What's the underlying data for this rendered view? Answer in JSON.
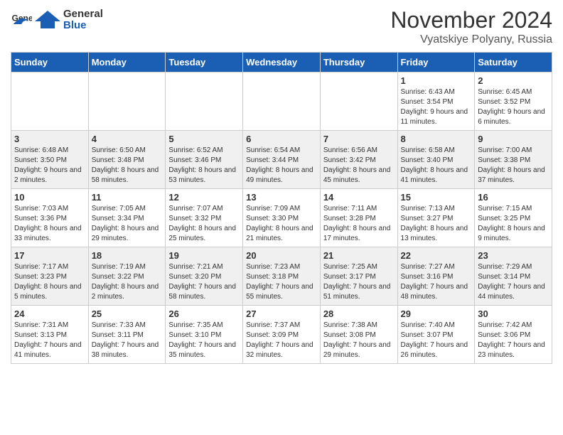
{
  "header": {
    "logo_general": "General",
    "logo_blue": "Blue",
    "month_year": "November 2024",
    "location": "Vyatskiye Polyany, Russia"
  },
  "days_of_week": [
    "Sunday",
    "Monday",
    "Tuesday",
    "Wednesday",
    "Thursday",
    "Friday",
    "Saturday"
  ],
  "weeks": [
    [
      {
        "day": "",
        "info": ""
      },
      {
        "day": "",
        "info": ""
      },
      {
        "day": "",
        "info": ""
      },
      {
        "day": "",
        "info": ""
      },
      {
        "day": "",
        "info": ""
      },
      {
        "day": "1",
        "info": "Sunrise: 6:43 AM\nSunset: 3:54 PM\nDaylight: 9 hours and 11 minutes."
      },
      {
        "day": "2",
        "info": "Sunrise: 6:45 AM\nSunset: 3:52 PM\nDaylight: 9 hours and 6 minutes."
      }
    ],
    [
      {
        "day": "3",
        "info": "Sunrise: 6:48 AM\nSunset: 3:50 PM\nDaylight: 9 hours and 2 minutes."
      },
      {
        "day": "4",
        "info": "Sunrise: 6:50 AM\nSunset: 3:48 PM\nDaylight: 8 hours and 58 minutes."
      },
      {
        "day": "5",
        "info": "Sunrise: 6:52 AM\nSunset: 3:46 PM\nDaylight: 8 hours and 53 minutes."
      },
      {
        "day": "6",
        "info": "Sunrise: 6:54 AM\nSunset: 3:44 PM\nDaylight: 8 hours and 49 minutes."
      },
      {
        "day": "7",
        "info": "Sunrise: 6:56 AM\nSunset: 3:42 PM\nDaylight: 8 hours and 45 minutes."
      },
      {
        "day": "8",
        "info": "Sunrise: 6:58 AM\nSunset: 3:40 PM\nDaylight: 8 hours and 41 minutes."
      },
      {
        "day": "9",
        "info": "Sunrise: 7:00 AM\nSunset: 3:38 PM\nDaylight: 8 hours and 37 minutes."
      }
    ],
    [
      {
        "day": "10",
        "info": "Sunrise: 7:03 AM\nSunset: 3:36 PM\nDaylight: 8 hours and 33 minutes."
      },
      {
        "day": "11",
        "info": "Sunrise: 7:05 AM\nSunset: 3:34 PM\nDaylight: 8 hours and 29 minutes."
      },
      {
        "day": "12",
        "info": "Sunrise: 7:07 AM\nSunset: 3:32 PM\nDaylight: 8 hours and 25 minutes."
      },
      {
        "day": "13",
        "info": "Sunrise: 7:09 AM\nSunset: 3:30 PM\nDaylight: 8 hours and 21 minutes."
      },
      {
        "day": "14",
        "info": "Sunrise: 7:11 AM\nSunset: 3:28 PM\nDaylight: 8 hours and 17 minutes."
      },
      {
        "day": "15",
        "info": "Sunrise: 7:13 AM\nSunset: 3:27 PM\nDaylight: 8 hours and 13 minutes."
      },
      {
        "day": "16",
        "info": "Sunrise: 7:15 AM\nSunset: 3:25 PM\nDaylight: 8 hours and 9 minutes."
      }
    ],
    [
      {
        "day": "17",
        "info": "Sunrise: 7:17 AM\nSunset: 3:23 PM\nDaylight: 8 hours and 5 minutes."
      },
      {
        "day": "18",
        "info": "Sunrise: 7:19 AM\nSunset: 3:22 PM\nDaylight: 8 hours and 2 minutes."
      },
      {
        "day": "19",
        "info": "Sunrise: 7:21 AM\nSunset: 3:20 PM\nDaylight: 7 hours and 58 minutes."
      },
      {
        "day": "20",
        "info": "Sunrise: 7:23 AM\nSunset: 3:18 PM\nDaylight: 7 hours and 55 minutes."
      },
      {
        "day": "21",
        "info": "Sunrise: 7:25 AM\nSunset: 3:17 PM\nDaylight: 7 hours and 51 minutes."
      },
      {
        "day": "22",
        "info": "Sunrise: 7:27 AM\nSunset: 3:16 PM\nDaylight: 7 hours and 48 minutes."
      },
      {
        "day": "23",
        "info": "Sunrise: 7:29 AM\nSunset: 3:14 PM\nDaylight: 7 hours and 44 minutes."
      }
    ],
    [
      {
        "day": "24",
        "info": "Sunrise: 7:31 AM\nSunset: 3:13 PM\nDaylight: 7 hours and 41 minutes."
      },
      {
        "day": "25",
        "info": "Sunrise: 7:33 AM\nSunset: 3:11 PM\nDaylight: 7 hours and 38 minutes."
      },
      {
        "day": "26",
        "info": "Sunrise: 7:35 AM\nSunset: 3:10 PM\nDaylight: 7 hours and 35 minutes."
      },
      {
        "day": "27",
        "info": "Sunrise: 7:37 AM\nSunset: 3:09 PM\nDaylight: 7 hours and 32 minutes."
      },
      {
        "day": "28",
        "info": "Sunrise: 7:38 AM\nSunset: 3:08 PM\nDaylight: 7 hours and 29 minutes."
      },
      {
        "day": "29",
        "info": "Sunrise: 7:40 AM\nSunset: 3:07 PM\nDaylight: 7 hours and 26 minutes."
      },
      {
        "day": "30",
        "info": "Sunrise: 7:42 AM\nSunset: 3:06 PM\nDaylight: 7 hours and 23 minutes."
      }
    ]
  ]
}
